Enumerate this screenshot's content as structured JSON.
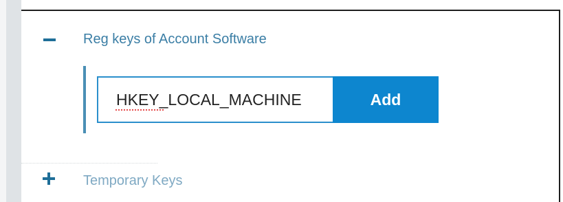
{
  "sections": [
    {
      "title": "Reg keys of Account Software",
      "expanded": true,
      "toggle_icon": "minus-icon"
    },
    {
      "title": "Temporary Keys",
      "expanded": false,
      "toggle_icon": "plus-icon"
    }
  ],
  "reg_key_input": {
    "value": "HKEY_LOCAL_MACHINE"
  },
  "add_button": {
    "label": "Add"
  },
  "colors": {
    "accent": "#0d86cf",
    "section_title": "#3b7ea5",
    "toggle": "#1e6e98",
    "input_border": "#2a8fcc"
  }
}
